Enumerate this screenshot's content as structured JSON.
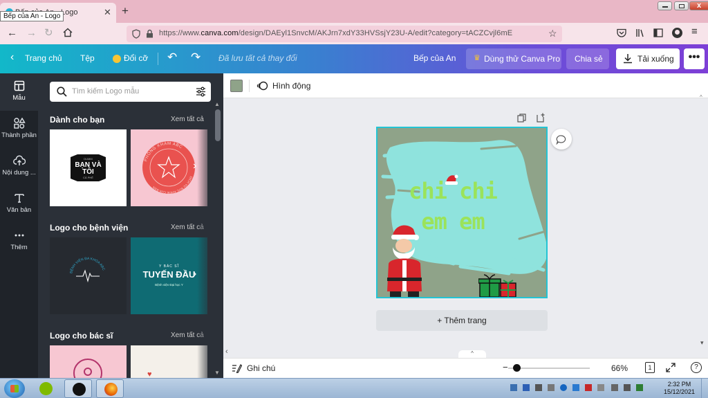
{
  "browser": {
    "tab_title": "Bếp của An - Logo",
    "tab_tooltip": "Bếp của An - Logo",
    "url_prefix": "https://www.",
    "url_domain": "canva.com",
    "url_path": "/design/DAEyl1SnvcM/AKJrn7xdY33HVSsjY23U-A/edit?category=tACZCvjl6mE"
  },
  "topbar": {
    "home": "Trang chủ",
    "file": "Tệp",
    "resize": "Đổi cỡ",
    "saved_status": "Đã lưu tất cả thay đổi",
    "team_name": "Bếp của An",
    "try_pro": "Dùng thử Canva Pro",
    "share": "Chia sẻ",
    "download": "Tải xuống",
    "more": "•••"
  },
  "rail": [
    {
      "label": "Mẫu",
      "icon": "template-icon"
    },
    {
      "label": "Thành phần",
      "icon": "elements-icon"
    },
    {
      "label": "Nội dung ...",
      "icon": "upload-icon"
    },
    {
      "label": "Văn bản",
      "icon": "text-icon"
    },
    {
      "label": "Thêm",
      "icon": "more-icon"
    }
  ],
  "panel": {
    "search_placeholder": "Tìm kiếm Logo mẫu",
    "sections": [
      {
        "title": "Dành cho bạn",
        "link": "Xem tất cả"
      },
      {
        "title": "Logo cho bệnh viện",
        "link": "Xem tất cả"
      },
      {
        "title": "Logo cho bác sĩ",
        "link": "Xem tất cả"
      }
    ],
    "tiles": {
      "t1_top": "DUMM",
      "t1_main": "BẠN VÀ",
      "t1_main2": "TÔI",
      "t1_sub": "CÀ PHÊ",
      "t2_ring": "PHÒNG KHÁM ABC",
      "t2_ring_bottom": "DỊCH VỤ SỨC KHỎE CỦA BẠN",
      "t3_ring": "BỆNH VIỆN ĐA KHOA ABC",
      "t4_top": "Y BÁC SĨ",
      "t4_main": "TUYẾN ĐẦU",
      "t4_sub": "Bệnh viện Đại học Y"
    }
  },
  "editor": {
    "animate": "Hình động",
    "canvas_line1": "chi chi",
    "canvas_line2": "em em",
    "add_page": "+ Thêm trang",
    "notes": "Ghi chú",
    "zoom": "66%",
    "zoom_fraction": 0.1,
    "page_count": "1",
    "help": "?"
  },
  "taskbar": {
    "time": "2:32 PM",
    "date": "15/12/2021"
  },
  "colors": {
    "canvas_bg": "#8fa389",
    "brush": "#8fe3dd",
    "canvas_text": "#9be35a",
    "selection": "#23c4d4"
  }
}
